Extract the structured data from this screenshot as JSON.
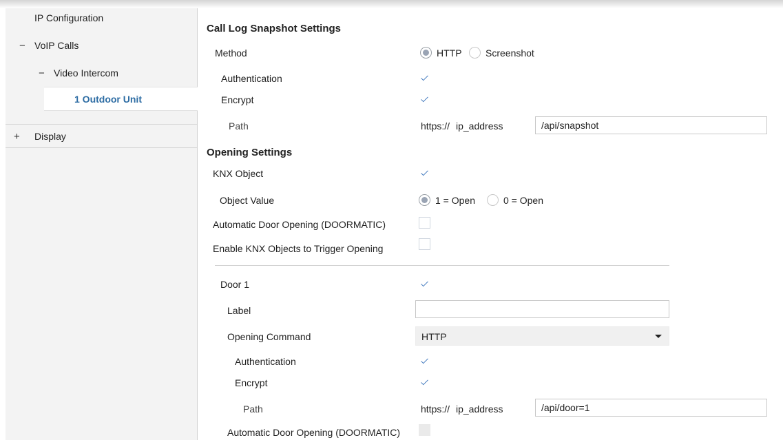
{
  "sidebar": {
    "items": [
      {
        "label": "IP Configuration",
        "toggle": ""
      },
      {
        "label": "VoIP Calls",
        "toggle": "−"
      },
      {
        "label": "Video Intercom",
        "toggle": "−"
      },
      {
        "label": "1 Outdoor Unit",
        "toggle": ""
      },
      {
        "label": "Display",
        "toggle": "+"
      }
    ]
  },
  "snapshot": {
    "title": "Call Log Snapshot Settings",
    "method_label": "Method",
    "method_options": [
      "HTTP",
      "Screenshot"
    ],
    "method_selected": "HTTP",
    "authentication_label": "Authentication",
    "authentication_checked": true,
    "encrypt_label": "Encrypt",
    "encrypt_checked": true,
    "path_label": "Path",
    "path_prefix": "https://",
    "path_host": "ip_address",
    "path_value": "/api/snapshot"
  },
  "opening": {
    "title": "Opening Settings",
    "knx_object_label": "KNX Object",
    "knx_object_checked": true,
    "object_value_label": "Object Value",
    "object_value_options": [
      "1 = Open",
      "0 = Open"
    ],
    "object_value_selected": "1 = Open",
    "doormatic_label": "Automatic Door Opening (DOORMATIC)",
    "doormatic_checked": false,
    "enable_knx_label": "Enable KNX Objects to Trigger Opening",
    "enable_knx_checked": false
  },
  "door1": {
    "label": "Door 1",
    "checked": true,
    "label_field_label": "Label",
    "label_field_value": "",
    "opening_command_label": "Opening Command",
    "opening_command_value": "HTTP",
    "authentication_label": "Authentication",
    "authentication_checked": true,
    "encrypt_label": "Encrypt",
    "encrypt_checked": true,
    "path_label": "Path",
    "path_prefix": "https://",
    "path_host": "ip_address",
    "path_value": "/api/door=1",
    "doormatic_label": "Automatic Door Opening (DOORMATIC)",
    "doormatic_checked": false
  }
}
